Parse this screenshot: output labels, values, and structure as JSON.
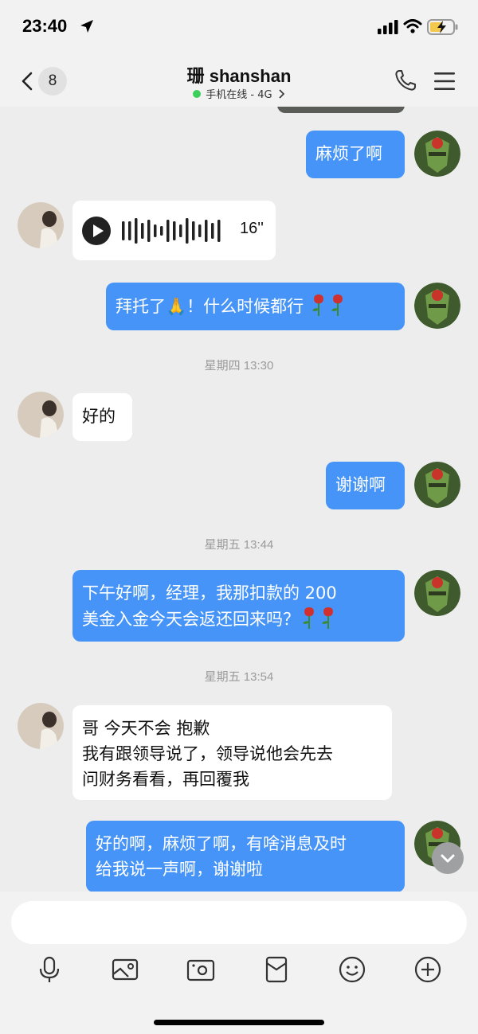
{
  "status_bar": {
    "time": "23:40"
  },
  "header": {
    "unread_count": "8",
    "contact_name": "珊 shanshan",
    "online_status": "手机在线 - 4G"
  },
  "messages": {
    "m1": "麻烦了啊",
    "voice_duration": "16''",
    "m3": "拜托了🙏！什么时候都行",
    "ts1": "星期四 13:30",
    "m4": "好的",
    "m5": "谢谢啊",
    "ts2": "星期五 13:44",
    "m6_line1": "下午好啊，经理，我那扣款的 200",
    "m6_line2": "美金入金今天会返还回来吗？",
    "ts3": "星期五 13:54",
    "m7_line1": "哥 今天不会 抱歉",
    "m7_line2": "我有跟领导说了，领导说他会先去",
    "m7_line3": "问财务看看，再回覆我",
    "m8_line1": "好的啊，麻烦了啊，有啥消息及时",
    "m8_line2": "给我说一声啊，谢谢啦"
  },
  "input": {
    "placeholder": ""
  },
  "toolbar": [
    "mic-icon",
    "photo-icon",
    "camera-icon",
    "red-packet-icon",
    "emoji-icon",
    "plus-icon"
  ],
  "colors": {
    "outgoing_bubble": "#4694f7",
    "incoming_bubble": "#ffffff",
    "background": "#ededed",
    "online": "#3ccf5c"
  }
}
